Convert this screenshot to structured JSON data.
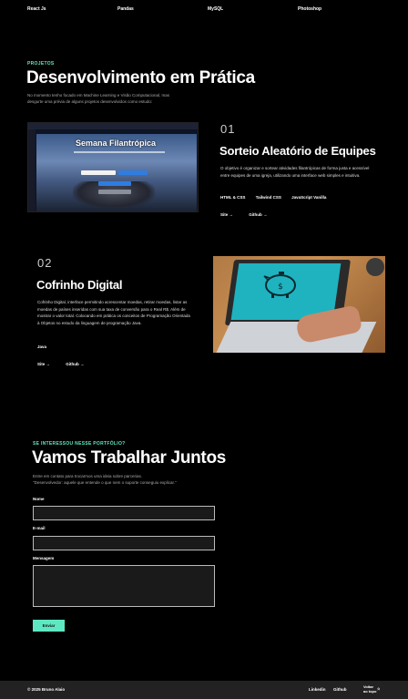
{
  "nav": {
    "skills": [
      "React Js",
      "Pandas",
      "MySQL",
      "Photoshop"
    ]
  },
  "projects": {
    "eyebrow": "PROJETOS",
    "title": "Desenvolvimento em Prática",
    "description": "No momento tenho focado em Machine Learning e Visão Computacional, mas desgurte uma prévia de alguns projetos desenvolvidos como estudo:",
    "items": [
      {
        "number": "01",
        "title": "Sorteio Aleatório de Equipes",
        "screenshot_title": "Semana Filantrópica",
        "description": "O objetivo é organizar e sortear atividades filantrópicas de forma justa e acessível entre equipes de uma igreja, utilizando uma interface web simples e intuitiva.",
        "tags": [
          "HTML & CSS",
          "Tailwind CSS",
          "JavaScript Vanilla"
        ],
        "links": [
          "Site →",
          "Github →"
        ]
      },
      {
        "number": "02",
        "title": "Cofrinho Digital",
        "description": "Cofrinho Digital, interface permitindo acrescentar moedas, retirar moedas, listar as moedas de países inseridas com sua taxa de conversão para o Real R$. Além de mostrar o valor total. Colocando em prática os conceitos de Programação Orientada à Objetos no estudo da linguagem de programação Java.",
        "tags": [
          "Java"
        ],
        "links": [
          "Site →",
          "Github →"
        ]
      }
    ]
  },
  "contact": {
    "eyebrow": "SE INTERESSOU NESSE PORTFÓLIO?",
    "title": "Vamos Trabalhar Juntos",
    "description_line1": "Entre em contato para trocarmos uma ideia sobre parcerias.",
    "description_line2": "\"Desenvolvedor: aquele que entende o que nem o suporte conseguiu explicar.\"",
    "name_label": "Nome",
    "email_label": "E-mail",
    "message_label": "Mensagem",
    "send_label": "Enviar"
  },
  "footer": {
    "copyright": "© 2025 Bruno Alaio",
    "links": [
      "Linkedin",
      "Github"
    ],
    "back_to_top": "Voltar ao topo"
  },
  "colors": {
    "accent": "#5ee8c2",
    "background": "#000000",
    "footer": "#222222"
  }
}
